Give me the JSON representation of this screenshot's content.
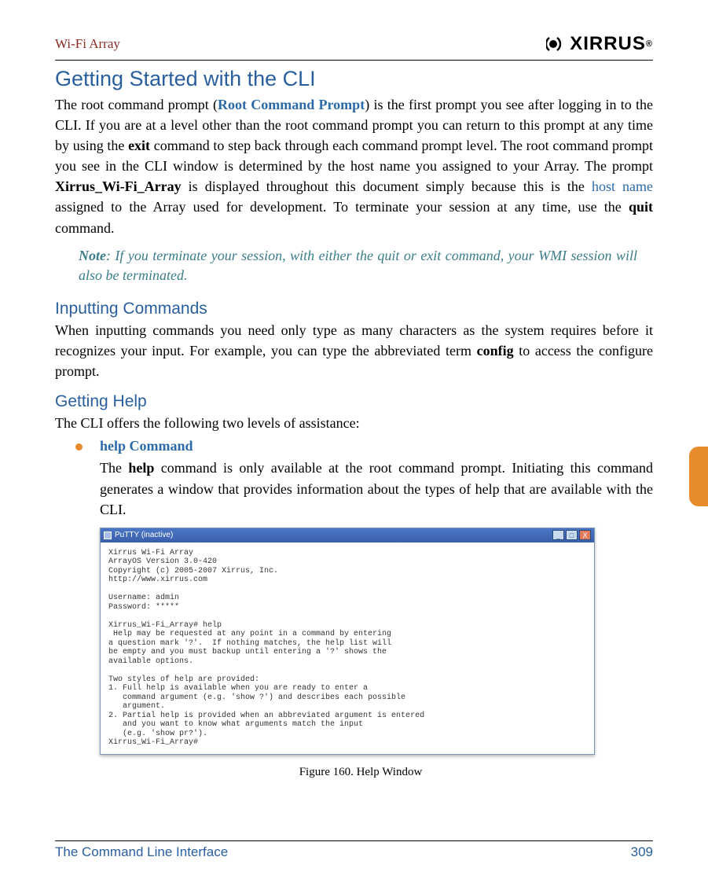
{
  "header": {
    "title": "Wi-Fi Array",
    "logo_text": "XIRRUS",
    "logo_mark": "logo-icon"
  },
  "section1": {
    "title": "Getting Started with the CLI",
    "p1_a": "The root command prompt (",
    "p1_link": "Root Command Prompt",
    "p1_b": ") is the first prompt you see after logging in to the CLI. If you are at a level other than the root command prompt you can return to this prompt at any time by using the ",
    "p1_bold1": "exit",
    "p1_c": " command to step back through each command prompt level. The root command prompt you see in the CLI window is determined by the host name you assigned to your Array. The prompt ",
    "p1_bold2": "Xirrus_Wi-Fi_Array",
    "p1_d": " is displayed throughout this document simply because this is the ",
    "p1_link2": "host name",
    "p1_e": " assigned to the Array used for development. To terminate your session at any time, use the ",
    "p1_bold3": "quit",
    "p1_f": " command."
  },
  "note": {
    "label": "Note",
    "text": ": If you terminate your session, with either the quit or exit command, your WMI session will also be terminated."
  },
  "section2": {
    "title": "Inputting Commands",
    "p_a": "When inputting commands you need only type as many characters as the system requires before it recognizes your input. For example, you can type the abbreviated term ",
    "p_bold": "config",
    "p_b": " to access the configure prompt."
  },
  "section3": {
    "title": "Getting Help",
    "intro": "The CLI offers the following two levels of assistance:",
    "bullet_title": "help Command",
    "bullet_body_a": "The ",
    "bullet_body_bold": "help",
    "bullet_body_b": " command is only available at the root command prompt. Initiating this command generates a window that provides information about the types of help that are available with the CLI."
  },
  "putty": {
    "title": "PuTTY (inactive)",
    "minimize": "_",
    "maximize": "□",
    "close": "X",
    "lines": "Xirrus Wi-Fi Array\nArrayOS Version 3.0-420\nCopyright (c) 2005-2007 Xirrus, Inc.\nhttp://www.xirrus.com\n\nUsername: admin\nPassword: *****\n\nXirrus_Wi-Fi_Array# help\n Help may be requested at any point in a command by entering\na question mark '?'.  If nothing matches, the help list will\nbe empty and you must backup until entering a '?' shows the\navailable options.\n\nTwo styles of help are provided:\n1. Full help is available when you are ready to enter a\n   command argument (e.g. 'show ?') and describes each possible\n   argument.\n2. Partial help is provided when an abbreviated argument is entered\n   and you want to know what arguments match the input\n   (e.g. 'show pr?').\nXirrus_Wi-Fi_Array#"
  },
  "caption": "Figure 160. Help Window",
  "footer": {
    "left": "The Command Line Interface",
    "right": "309"
  }
}
